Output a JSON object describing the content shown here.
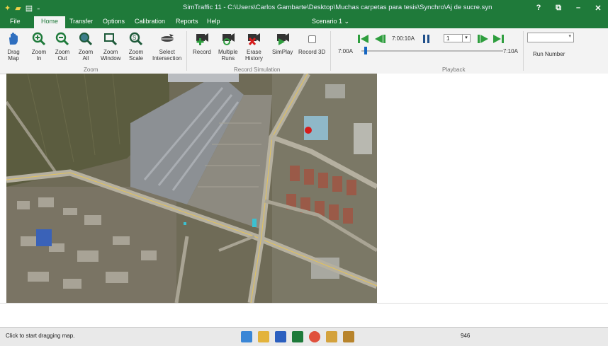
{
  "window": {
    "title": "SimTraffic 11 - C:\\Users\\Carlos Gambarte\\Desktop\\Muchas carpetas para tesis\\Synchro\\Aj de sucre.syn",
    "controls": [
      "?",
      "⧉",
      "–",
      "✕"
    ]
  },
  "tabs": [
    {
      "label": "File"
    },
    {
      "label": "Home"
    },
    {
      "label": "Transfer"
    },
    {
      "label": "Options"
    },
    {
      "label": "Calibration"
    },
    {
      "label": "Reports"
    },
    {
      "label": "Help"
    }
  ],
  "active_tab": "Home",
  "scenario": "Scenario 1 ⌄",
  "ribbon": {
    "zoom_buttons": [
      {
        "label1": "Drag",
        "label2": "Map",
        "icon": "hand-icon"
      },
      {
        "label1": "Zoom",
        "label2": "In",
        "icon": "zoom-in-icon"
      },
      {
        "label1": "Zoom",
        "label2": "Out",
        "icon": "zoom-out-icon"
      },
      {
        "label1": "Zoom",
        "label2": "All",
        "icon": "zoom-all-icon"
      },
      {
        "label1": "Zoom",
        "label2": "Window",
        "icon": "zoom-window-icon"
      },
      {
        "label1": "Zoom",
        "label2": "Scale",
        "icon": "zoom-scale-icon"
      },
      {
        "label1": "Select",
        "label2": "Intersection",
        "icon": "select-intersection-icon"
      }
    ],
    "zoom_group_label": "Zoom",
    "record_buttons": [
      {
        "label1": "Record",
        "label2": "",
        "icon": "record-icon"
      },
      {
        "label1": "Multiple",
        "label2": "Runs",
        "icon": "multiple-runs-icon"
      },
      {
        "label1": "Erase",
        "label2": "History",
        "icon": "erase-history-icon"
      },
      {
        "label1": "SimPlay",
        "label2": "",
        "icon": "simplay-icon"
      },
      {
        "label1": "Record 3D",
        "label2": "",
        "icon": "record-3d-checkbox"
      }
    ],
    "record_group_label": "Record Simulation",
    "playback": {
      "current_time": "7:00:10A",
      "start_time": "7:00A",
      "end_time": "7:10A",
      "speed": "1",
      "position": 0.02,
      "group_label": "Playback"
    },
    "run_number_label": "Run Number",
    "run_number_value": ""
  },
  "status": {
    "message": "Click to start dragging map.",
    "value": "946"
  },
  "colors": {
    "brand": "#1f7a3a",
    "accent": "#2e9e3e",
    "marker": "#d61c1c"
  }
}
